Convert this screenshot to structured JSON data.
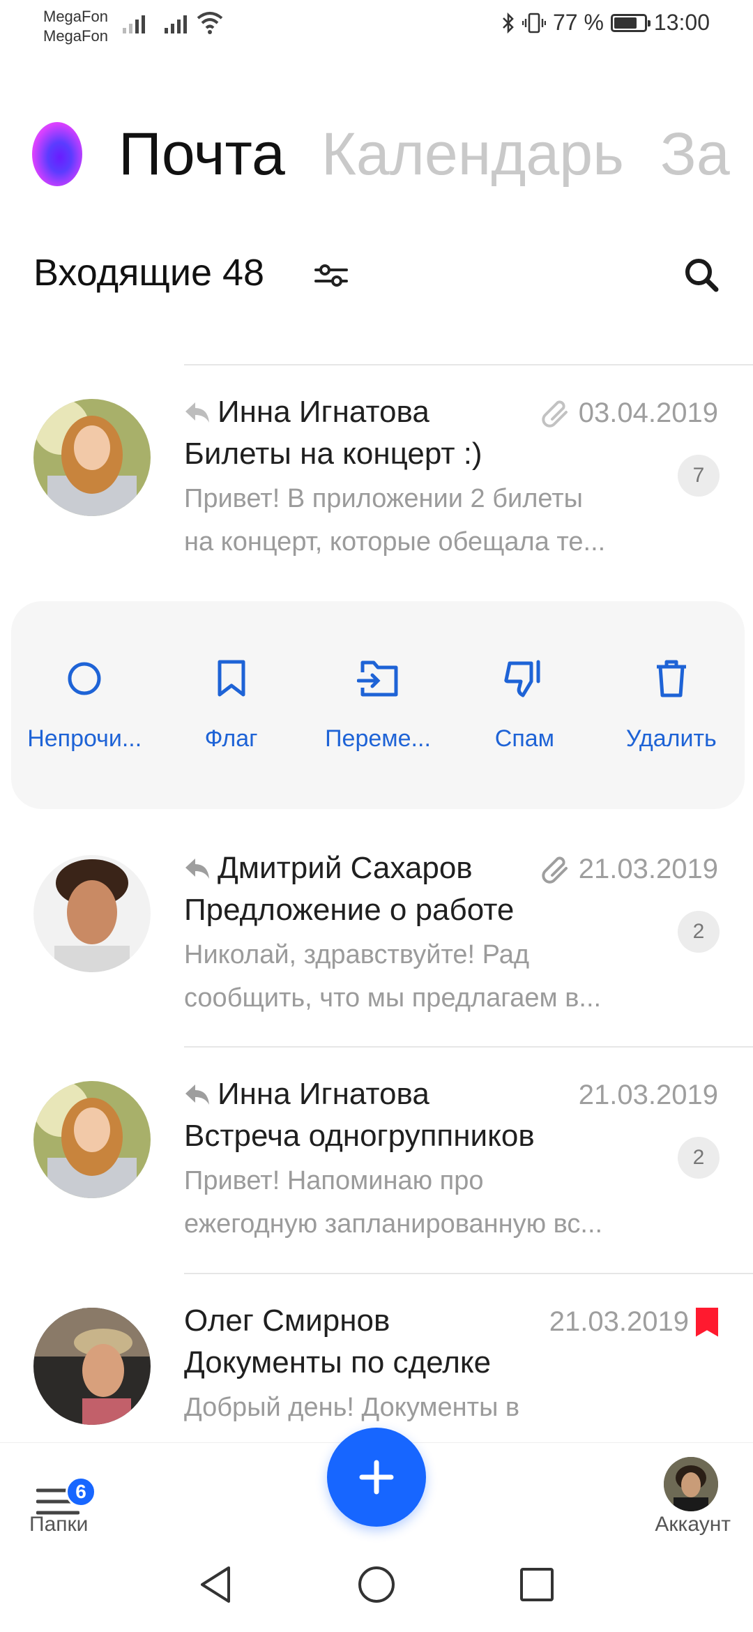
{
  "status_bar": {
    "carrier1": "MegaFon",
    "carrier2": "MegaFon",
    "battery_percent": "77 %",
    "battery_level": 0.77,
    "time": "13:00"
  },
  "app_tabs": [
    {
      "label": "Почта",
      "active": true
    },
    {
      "label": "Календарь",
      "active": false
    },
    {
      "label": "За",
      "active": false
    }
  ],
  "header": {
    "title": "Входящие 48"
  },
  "mails": [
    {
      "sender": "Инна Игнатова",
      "replied": true,
      "attachment": true,
      "date": "03.04.2019",
      "subject": "Билеты на концерт :)",
      "snippet_line1": "Привет! В приложении 2 билеты",
      "snippet_line2": "на концерт, которые обещала те...",
      "count": "7"
    },
    {
      "sender": "Дмитрий Сахаров",
      "replied": true,
      "attachment": true,
      "date": "21.03.2019",
      "subject": "Предложение о работе",
      "snippet_line1": "Николай, здравствуйте! Рад",
      "snippet_line2": "сообщить, что мы предлагаем в...",
      "count": "2"
    },
    {
      "sender": "Инна Игнатова",
      "replied": true,
      "attachment": false,
      "date": "21.03.2019",
      "subject": "Встреча одногруппников",
      "snippet_line1": "Привет! Напоминаю про",
      "snippet_line2": "ежегодную запланированную вс...",
      "count": "2"
    },
    {
      "sender": "Олег Смирнов",
      "replied": false,
      "attachment": false,
      "flagged": true,
      "date": "21.03.2019",
      "subject": "Документы по сделке",
      "snippet_line1": "Добрый день! Документы в",
      "snippet_line2": ""
    }
  ],
  "swipe_actions": [
    {
      "label": "Непрочи...",
      "icon": "circle-icon"
    },
    {
      "label": "Флаг",
      "icon": "bookmark-icon"
    },
    {
      "label": "Переме...",
      "icon": "move-folder-icon"
    },
    {
      "label": "Спам",
      "icon": "thumbs-down-icon"
    },
    {
      "label": "Удалить",
      "icon": "trash-icon"
    }
  ],
  "bottom_bar": {
    "folders_label": "Папки",
    "folders_badge": "6",
    "account_label": "Аккаунт"
  },
  "colors": {
    "accent": "#1766ff",
    "action_text": "#1e63d6",
    "flag": "#ff1a2f"
  }
}
